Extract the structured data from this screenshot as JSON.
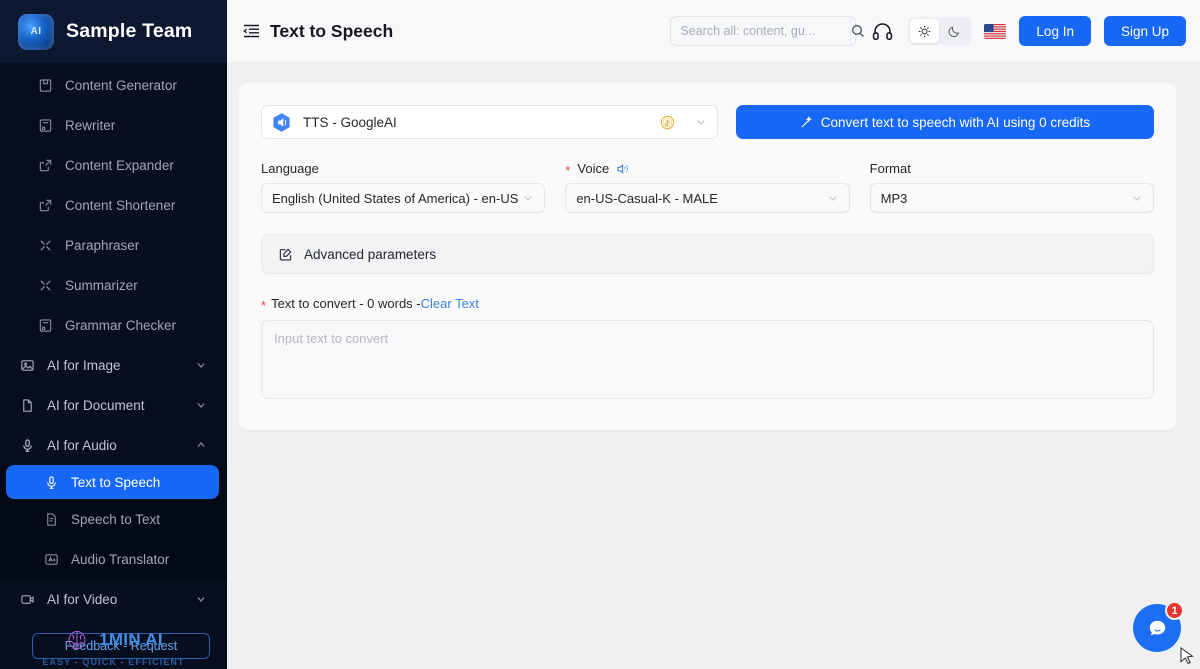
{
  "sidebar": {
    "team_name": "Sample Team",
    "team_logo_text": "AI",
    "items": [
      {
        "label": "Content Generator",
        "icon": "document-save-icon",
        "type": "item"
      },
      {
        "label": "Rewriter",
        "icon": "rewrite-icon",
        "type": "item"
      },
      {
        "label": "Content Expander",
        "icon": "expand-icon",
        "type": "item"
      },
      {
        "label": "Content Shortener",
        "icon": "shorten-icon",
        "type": "item"
      },
      {
        "label": "Paraphraser",
        "icon": "shuffle-icon",
        "type": "item"
      },
      {
        "label": "Summarizer",
        "icon": "shuffle-icon",
        "type": "item"
      },
      {
        "label": "Grammar Checker",
        "icon": "grammar-icon",
        "type": "item"
      }
    ],
    "groups": [
      {
        "label": "AI for Image",
        "icon": "image-icon",
        "expanded": false
      },
      {
        "label": "AI for Document",
        "icon": "file-icon",
        "expanded": false
      },
      {
        "label": "AI for Audio",
        "icon": "microphone-icon",
        "expanded": true
      },
      {
        "label": "AI for Video",
        "icon": "video-icon",
        "expanded": false
      }
    ],
    "audio_children": [
      {
        "label": "Text to Speech",
        "icon": "microphone-icon",
        "active": true
      },
      {
        "label": "Speech to Text",
        "icon": "file-text-icon",
        "active": false
      },
      {
        "label": "Audio Translator",
        "icon": "translate-icon",
        "active": false
      }
    ],
    "feedback_label": "Feedback - Request",
    "brand_name": "1MIN AI",
    "brand_tagline": "EASY - QUICK - EFFICIENT"
  },
  "header": {
    "title": "Text to Speech",
    "collapse_icon": "collapse-sidebar-icon",
    "search": {
      "placeholder": "Search all: content, gu...",
      "value": "",
      "icon": "search-icon"
    },
    "headphones_icon": "headphones-icon",
    "theme": {
      "light_icon": "sun-icon",
      "dark_icon": "moon-icon",
      "selected": "light"
    },
    "flag": "us-flag-icon",
    "login_label": "Log In",
    "signup_label": "Sign Up"
  },
  "main": {
    "model": {
      "name": "TTS - GoogleAI",
      "icon": "google-tts-icon",
      "coin_icon": "credit-coin-icon",
      "chevron": "chevron-down-icon"
    },
    "convert_button": {
      "label": "Convert text to speech with AI using 0 credits",
      "icon": "magic-wand-icon"
    },
    "language": {
      "label": "Language",
      "value": "English (United States of America) - en-US"
    },
    "voice": {
      "label": "Voice",
      "value": "en-US-Casual-K - MALE",
      "required": "*",
      "icon": "speaker-icon"
    },
    "format": {
      "label": "Format",
      "value": "MP3"
    },
    "advanced": {
      "label": "Advanced parameters",
      "icon": "edit-square-icon"
    },
    "text_to_convert": {
      "required": "*",
      "label": "Text to convert - 0 words - ",
      "clear_label": "Clear Text",
      "placeholder": "Input text to convert",
      "value": ""
    }
  },
  "chat": {
    "icon": "chat-bubble-icon",
    "badge": "1"
  },
  "colors": {
    "accent": "#1668f5",
    "sidebar_bg": "#070f1e",
    "badge_red": "#e8342a",
    "link": "#3b82e8"
  }
}
